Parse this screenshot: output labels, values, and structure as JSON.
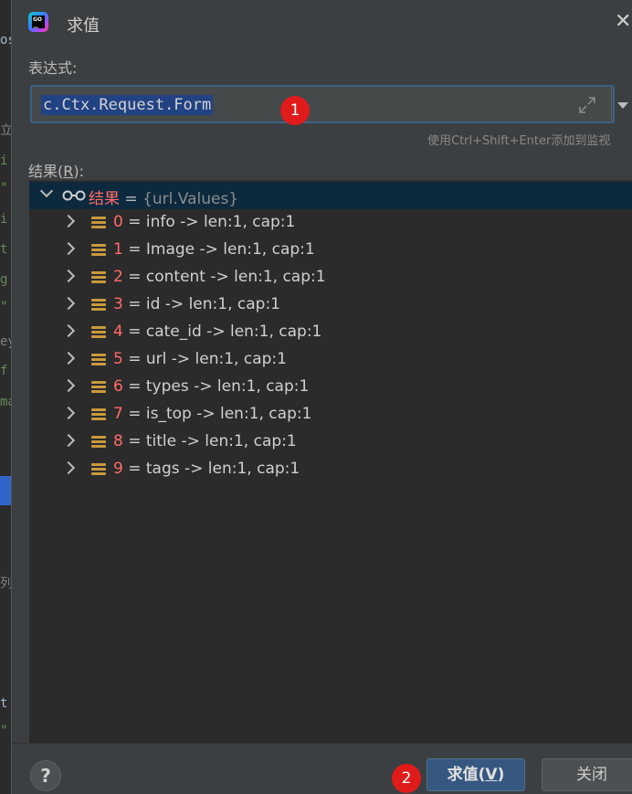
{
  "dialog": {
    "title": "求值",
    "expression_label": "表达式:",
    "expression_value": "c.Ctx.Request.Form",
    "hint": "使用Ctrl+Shift+Enter添加到监视",
    "result_label_pre": "结果(",
    "result_label_key": "R",
    "result_label_post": "):"
  },
  "result": {
    "root": {
      "name": "结果",
      "eq": " = ",
      "type": "{url.Values}"
    },
    "items": [
      {
        "index": "0",
        "text": " = info -> len:1, cap:1"
      },
      {
        "index": "1",
        "text": " = Image -> len:1, cap:1"
      },
      {
        "index": "2",
        "text": " = content -> len:1, cap:1"
      },
      {
        "index": "3",
        "text": " = id -> len:1, cap:1"
      },
      {
        "index": "4",
        "text": " = cate_id -> len:1, cap:1"
      },
      {
        "index": "5",
        "text": " = url -> len:1, cap:1"
      },
      {
        "index": "6",
        "text": " = types -> len:1, cap:1"
      },
      {
        "index": "7",
        "text": " = is_top -> len:1, cap:1"
      },
      {
        "index": "8",
        "text": " = title -> len:1, cap:1"
      },
      {
        "index": "9",
        "text": " = tags -> len:1, cap:1"
      }
    ]
  },
  "buttons": {
    "help": "?",
    "evaluate_pre": "求值(",
    "evaluate_key": "V",
    "evaluate_post": ")",
    "close": "关闭"
  },
  "badges": {
    "first": "1",
    "second": "2"
  },
  "background_code": [
    "os",
    "立",
    "i",
    "\"",
    "i",
    "t",
    "g",
    "\"",
    "ey",
    "f",
    "ma",
    "列",
    "t",
    "\""
  ],
  "colors": {
    "accent": "#365880",
    "index_red": "#ff6b68",
    "badge_red": "#e01b1b",
    "selection": "#0d293e"
  },
  "icons": {
    "app": "goland-icon",
    "close": "close-icon",
    "expand": "expand-icon",
    "dropdown": "dropdown-arrow-icon",
    "watch": "glasses-icon",
    "field": "field-lines-icon"
  }
}
